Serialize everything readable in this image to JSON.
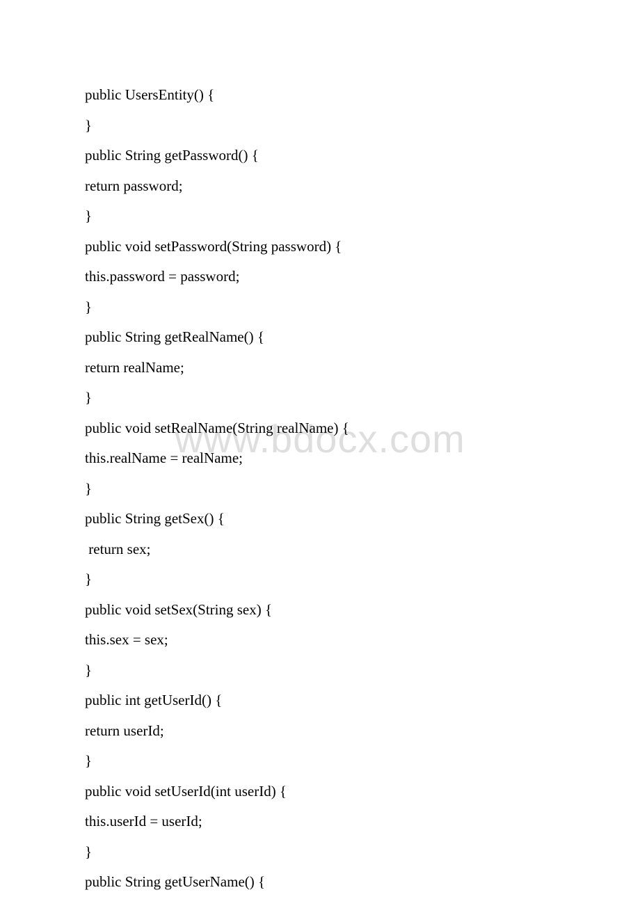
{
  "watermark": "www.bdocx.com",
  "code": {
    "lines": [
      "public UsersEntity() {",
      "}",
      "public String getPassword() {",
      "return password;",
      "}",
      "public void setPassword(String password) {",
      "this.password = password;",
      "}",
      "public String getRealName() {",
      "return realName;",
      "}",
      "public void setRealName(String realName) {",
      "this.realName = realName;",
      "}",
      "public String getSex() {",
      " return sex;",
      "}",
      "public void setSex(String sex) {",
      "this.sex = sex;",
      "}",
      "public int getUserId() {",
      "return userId;",
      "}",
      "public void setUserId(int userId) {",
      "this.userId = userId;",
      "}",
      "public String getUserName() {"
    ]
  }
}
